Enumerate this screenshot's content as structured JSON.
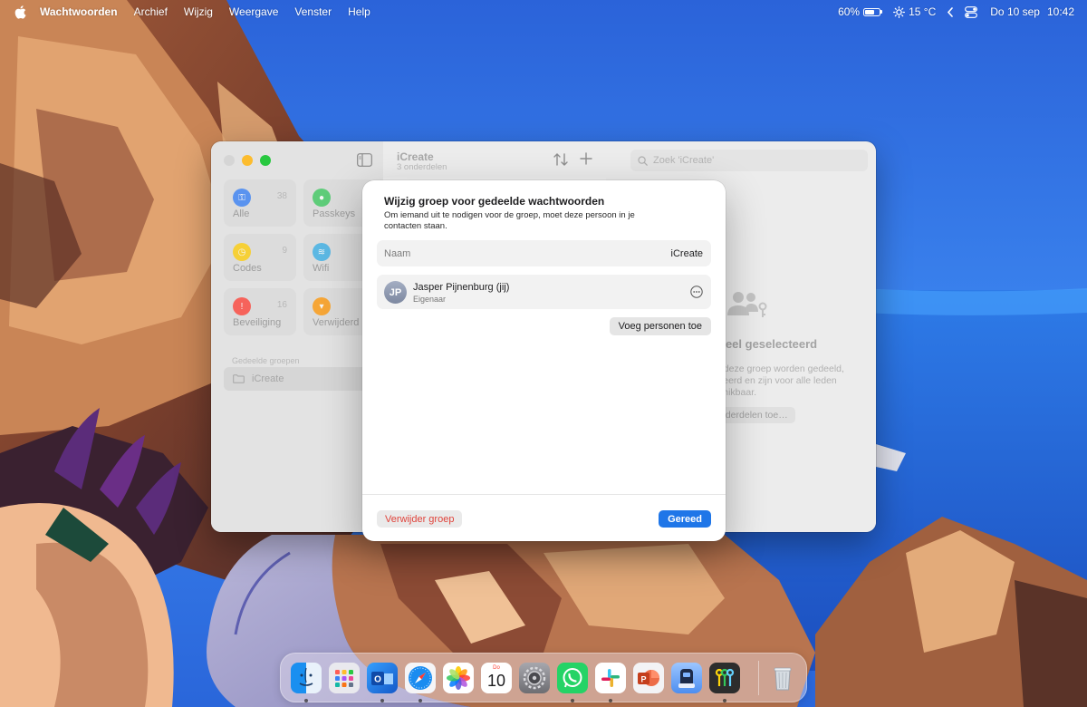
{
  "menubar": {
    "app_name": "Wachtwoorden",
    "menus": [
      "Archief",
      "Wijzig",
      "Weergave",
      "Venster",
      "Help"
    ],
    "battery_percent": "60%",
    "battery_level": 0.6,
    "weather": "15 °C",
    "date": "Do 10 sep",
    "time": "10:42"
  },
  "sidebar": {
    "tiles": [
      {
        "label": "Alle",
        "count": "38",
        "icon": "key-icon",
        "color": "#2f7bf6"
      },
      {
        "label": "Passkeys",
        "count": "",
        "icon": "person-key-icon",
        "color": "#34c759"
      },
      {
        "label": "Codes",
        "count": "9",
        "icon": "lock-clock-icon",
        "color": "#ffcc00"
      },
      {
        "label": "Wifi",
        "count": "",
        "icon": "wifi-icon",
        "color": "#32ade6"
      },
      {
        "label": "Beveiliging",
        "count": "16",
        "icon": "exclamation-icon",
        "color": "#ff3b30"
      },
      {
        "label": "Verwijderd",
        "count": "",
        "icon": "trash-icon",
        "color": "#ff9500"
      }
    ],
    "section_title": "Gedeelde groepen",
    "group": "iCreate"
  },
  "list": {
    "title": "iCreate",
    "subtitle": "3 onderdelen"
  },
  "search": {
    "placeholder": "Zoek 'iCreate'"
  },
  "detail": {
    "title": "deel geselecteerd",
    "text": "t deze groep worden gedeeld,\nseerd en zijn voor alle leden\nchikbaar.",
    "button": "nderdelen toe…"
  },
  "sheet": {
    "title": "Wijzig groep voor gedeelde wachtwoorden",
    "description": "Om iemand uit te nodigen voor de groep, moet deze persoon in je contacten staan.",
    "name_label": "Naam",
    "name_value": "iCreate",
    "member": {
      "initials": "JP",
      "name": "Jasper Pijnenburg (jij)",
      "role": "Eigenaar"
    },
    "add_people": "Voeg personen toe",
    "delete_group": "Verwijder groep",
    "done": "Gereed"
  },
  "dock": {
    "calendar_day_label": "Do",
    "calendar_date": "10",
    "apps": [
      {
        "name": "finder-icon",
        "color": "#1e9bf0"
      },
      {
        "name": "launchpad-icon",
        "color": "#e8e8ec"
      },
      {
        "name": "outlook-icon",
        "color": "#1f6fd0"
      },
      {
        "name": "safari-icon",
        "color": "#1a8cf0"
      },
      {
        "name": "photos-icon",
        "color": "#ffffff"
      },
      {
        "name": "calendar-icon",
        "color": "#ffffff"
      },
      {
        "name": "system-settings-icon",
        "color": "#8e8e93"
      },
      {
        "name": "whatsapp-icon",
        "color": "#25d366"
      },
      {
        "name": "slack-icon",
        "color": "#ffffff"
      },
      {
        "name": "powerpoint-icon",
        "color": "#d35230"
      },
      {
        "name": "remote-icon",
        "color": "#6aa6f5"
      },
      {
        "name": "passwords-icon",
        "color": "#2d2d2d"
      },
      {
        "name": "trash-bin-icon",
        "color": "#c8d0d8"
      }
    ]
  }
}
